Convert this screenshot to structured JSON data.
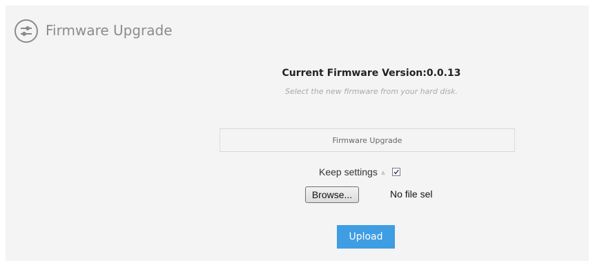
{
  "header": {
    "icon": "settings-sliders-icon",
    "title": "Firmware Upgrade"
  },
  "firmware": {
    "current_version_text": "Current Firmware Version:0.0.13",
    "hint": "Select the new firmware from your hard disk."
  },
  "upgrade_section": {
    "title": "Firmware Upgrade",
    "keep_settings_label": "Keep settings",
    "keep_settings_help_icon": "help-icon",
    "keep_settings_checked": true,
    "browse_label": "Browse...",
    "file_status": "No file sel",
    "upload_label": "Upload"
  },
  "colors": {
    "accent": "#3e9de3",
    "panel_background": "#f4f4f4"
  }
}
